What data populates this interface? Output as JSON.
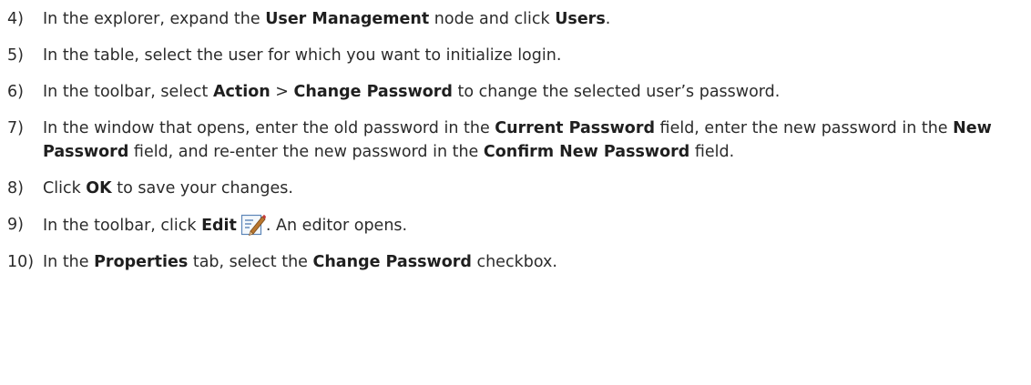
{
  "steps": [
    {
      "num": "4)",
      "parts": [
        {
          "t": "In the explorer, expand the "
        },
        {
          "t": "User Management",
          "b": true
        },
        {
          "t": " node and click "
        },
        {
          "t": "Users",
          "b": true
        },
        {
          "t": "."
        }
      ]
    },
    {
      "num": "5)",
      "parts": [
        {
          "t": "In the table, select the user for which you want to initialize login."
        }
      ]
    },
    {
      "num": "6)",
      "parts": [
        {
          "t": "In the toolbar, select "
        },
        {
          "t": "Action",
          "b": true
        },
        {
          "t": " > "
        },
        {
          "t": "Change Password",
          "b": true
        },
        {
          "t": " to change the selected user’s password."
        }
      ]
    },
    {
      "num": "7)",
      "parts": [
        {
          "t": "In the window that opens, enter the old password in the "
        },
        {
          "t": "Current Password",
          "b": true
        },
        {
          "t": " field, enter the new password in the "
        },
        {
          "t": "New Password",
          "b": true
        },
        {
          "t": " field, and re-enter the new password in the "
        },
        {
          "t": "Confirm New Password",
          "b": true
        },
        {
          "t": " field."
        }
      ]
    },
    {
      "num": "8)",
      "parts": [
        {
          "t": "Click "
        },
        {
          "t": "OK",
          "b": true
        },
        {
          "t": " to save your changes."
        }
      ]
    },
    {
      "num": "9)",
      "parts": [
        {
          "t": "In the toolbar, click "
        },
        {
          "t": "Edit",
          "b": true
        },
        {
          "icon": "edit-icon"
        },
        {
          "t": ". An editor opens."
        }
      ]
    },
    {
      "num": "10)",
      "parts": [
        {
          "t": "In the "
        },
        {
          "t": "Properties",
          "b": true
        },
        {
          "t": " tab, select the "
        },
        {
          "t": "Change Password",
          "b": true
        },
        {
          "t": " checkbox."
        }
      ]
    }
  ]
}
